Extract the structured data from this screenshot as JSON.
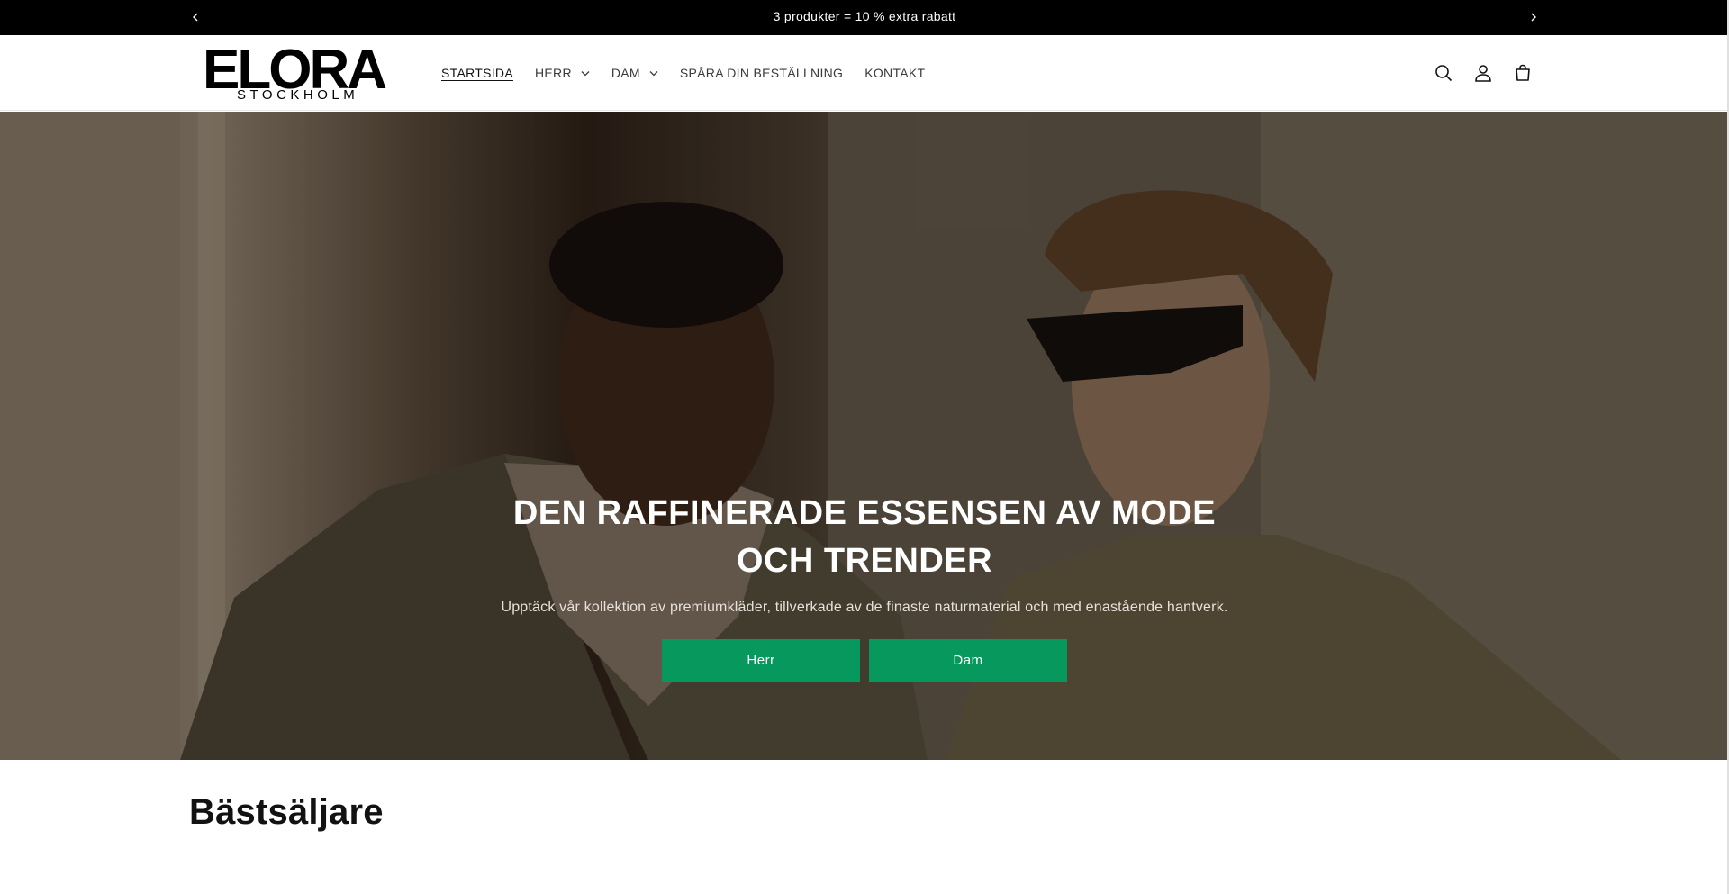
{
  "announcement": {
    "message": "3 produkter = 10 % extra rabatt",
    "prev_icon": "chevron-left-icon",
    "next_icon": "chevron-right-icon"
  },
  "header": {
    "logo": {
      "brand": "ELORA",
      "sub": "STOCKHOLM"
    },
    "nav": [
      {
        "label": "STARTSIDA",
        "active": true,
        "dropdown": false
      },
      {
        "label": "HERR",
        "active": false,
        "dropdown": true
      },
      {
        "label": "DAM",
        "active": false,
        "dropdown": true
      },
      {
        "label": "SPÅRA DIN BESTÄLLNING",
        "active": false,
        "dropdown": false
      },
      {
        "label": "KONTAKT",
        "active": false,
        "dropdown": false
      }
    ],
    "icons": [
      "search-icon",
      "account-icon",
      "cart-icon"
    ]
  },
  "hero": {
    "title": "DEN RAFFINERADE ESSENSEN AV MODE OCH TRENDER",
    "subtitle": "Upptäck vår kollektion av premiumkläder, tillverkade av de finaste naturmaterial och med enastående hantverk.",
    "buttons": [
      {
        "label": "Herr"
      },
      {
        "label": "Dam"
      }
    ],
    "button_color": "#06985d"
  },
  "bestsellers": {
    "heading": "Bästsäljare"
  }
}
